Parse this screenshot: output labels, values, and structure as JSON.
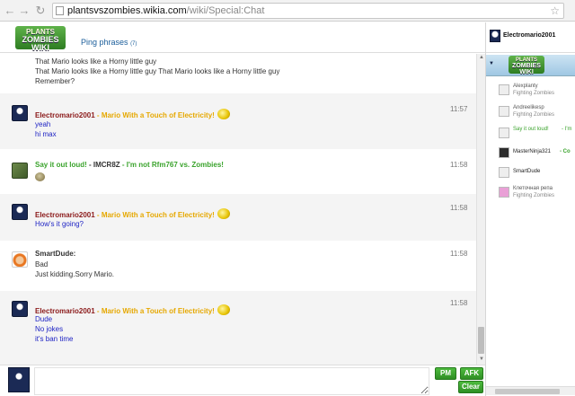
{
  "browser": {
    "url_domain": "plantsvszombies.wikia.com",
    "url_path": "/wiki/Special:Chat"
  },
  "header": {
    "logo_line1": "PLANTS",
    "logo_line2": "ZOMBIES WIKI",
    "ping_label": "Ping phrases",
    "ping_count": "(7)"
  },
  "messages": [
    {
      "type": "continuation",
      "lines": [
        "That Mario looks like a Horny little guy",
        "That Mario looks like a Horny little guy That Mario looks like a Horny little guy",
        "Remember?"
      ]
    },
    {
      "user": "Electromario2001",
      "status": " - Mario With a Touch of Electricity!",
      "time": "11:57",
      "lines": [
        "yeah",
        "hi max"
      ]
    },
    {
      "user": "Say it out loud!",
      "middle": " - IMCR8Z",
      "status": " - I'm not Rfm767 vs. Zombies!",
      "time": "11:58"
    },
    {
      "user": "Electromario2001",
      "status": " - Mario With a Touch of Electricity!",
      "time": "11:58",
      "lines": [
        "How's it going?"
      ]
    },
    {
      "user": "SmartDude:",
      "time": "11:58",
      "lines": [
        "Bad",
        "Just kidding.Sorry Mario."
      ]
    },
    {
      "user": "Electromario2001",
      "status": " - Mario With a Touch of Electricity!",
      "time": "11:58",
      "lines": [
        "Dude",
        "No jokes",
        "it's ban time"
      ]
    }
  ],
  "composer": {
    "pm_label": "PM",
    "afk_label": "AFK",
    "clear_label": "Clear"
  },
  "sidebar": {
    "me": "Electromario2001",
    "room_logo_line1": "PLANTS",
    "room_logo_line2": "ZOMBIES WIKI",
    "users": [
      {
        "name": "Alexplanty",
        "status": "Fighting Zombies"
      },
      {
        "name": "Andreelikesp",
        "status": "Fighting Zombies"
      },
      {
        "name": "Say it out loud!",
        "status": "- I'm"
      },
      {
        "name": "MasterNinja321",
        "status": "- Co"
      },
      {
        "name": "SmartDude",
        "status": ""
      },
      {
        "name": "Клеточная репа",
        "status": "Fighting Zombies"
      }
    ]
  }
}
